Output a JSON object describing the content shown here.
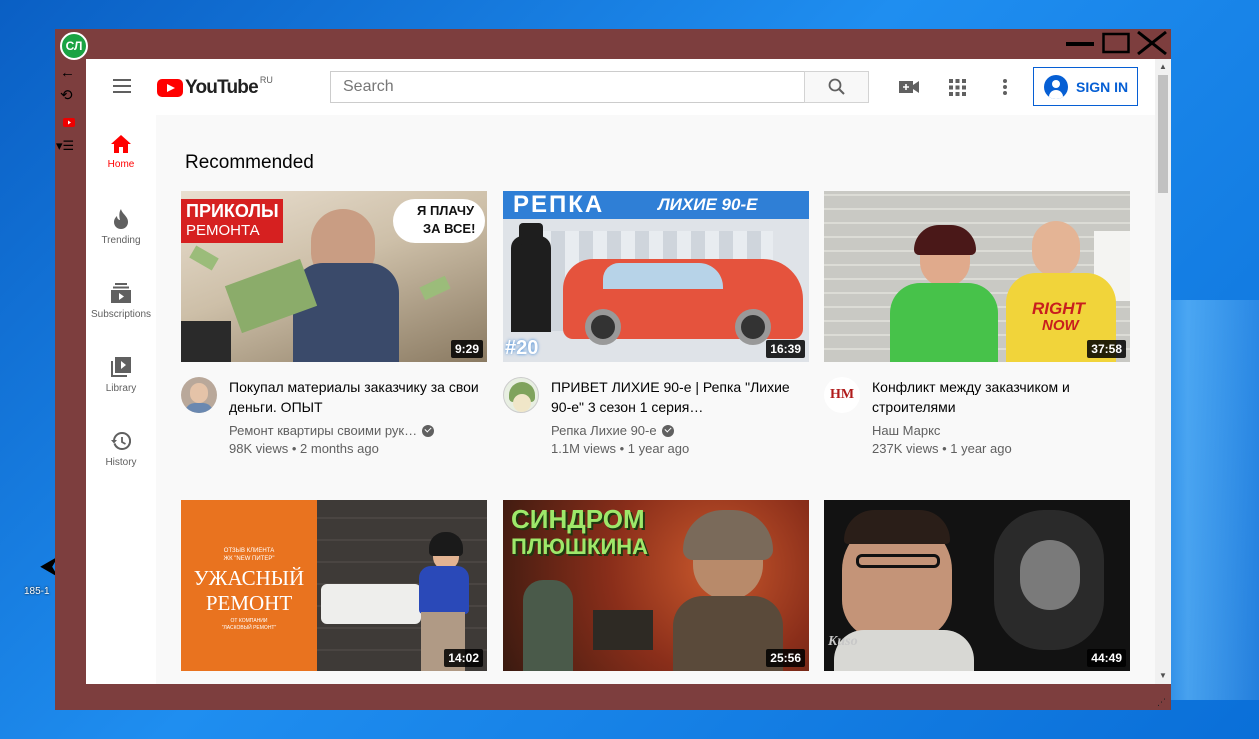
{
  "desktop": {
    "label": "185-1"
  },
  "app": {
    "badge": "СЛ"
  },
  "header": {
    "logo_word": "YouTube",
    "logo_region": "RU",
    "search_placeholder": "Search",
    "sign_in": "SIGN IN"
  },
  "sidebar": {
    "items": [
      {
        "label": "Home",
        "icon": "home-icon"
      },
      {
        "label": "Trending",
        "icon": "flame-icon"
      },
      {
        "label": "Subscriptions",
        "icon": "subscriptions-icon"
      },
      {
        "label": "Library",
        "icon": "library-icon"
      },
      {
        "label": "History",
        "icon": "history-icon"
      }
    ]
  },
  "main": {
    "section_title": "Recommended",
    "videos": [
      {
        "title": "Покупал материалы заказчику за свои деньги. ОПЫТ",
        "channel": "Ремонт квартиры своими рук…",
        "verified": true,
        "meta": "98K views • 2 months ago",
        "duration": "9:29",
        "thumb_text": [
          "ПРИКОЛЫ",
          "РЕМОНТА",
          "Я ПЛАЧУ",
          "ЗА ВСЕ!"
        ]
      },
      {
        "title": "ПРИВЕТ ЛИХИЕ 90-е | Репка \"Лихие 90-е\" 3 сезон 1 серия…",
        "channel": "Репка Лихие 90-е",
        "verified": true,
        "meta": "1.1M views • 1 year ago",
        "duration": "16:39",
        "thumb_text": [
          "РЕПКА",
          "ЛИХИЕ 90-Е",
          "#20"
        ]
      },
      {
        "title": "Конфликт между заказчиком и строителями",
        "channel": "Наш Маркс",
        "verified": false,
        "meta": "237K views • 1 year ago",
        "duration": "37:58",
        "avatar_text": "НМ",
        "thumb_text": [
          "RIGHT",
          "NOW"
        ]
      },
      {
        "duration": "14:02",
        "thumb_text": [
          "ОТЗЫВ КЛИЕНТА",
          "ЖК \"NEW ПИТЕР\"",
          "УЖАСНЫЙ",
          "РЕМОНТ",
          "ОТ КОМПАНИИ",
          "\"ЛАСКОВЫЙ РЕМОНТ\""
        ]
      },
      {
        "duration": "25:56",
        "thumb_text": [
          "СИНДРОМ",
          "ПЛЮШКИНА"
        ]
      },
      {
        "duration": "44:49",
        "thumb_text": [
          "Kuso"
        ]
      }
    ]
  },
  "colors": {
    "frame": "#7d3e3e",
    "accent": "#ff0000",
    "link": "#065fd4"
  }
}
